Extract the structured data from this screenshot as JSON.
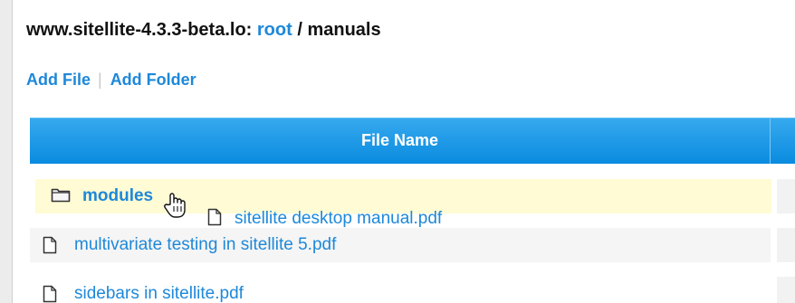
{
  "breadcrumb": {
    "site": "www.sitellite-4.3.3-beta.lo:",
    "root": "root",
    "separator": "/",
    "current": "manuals"
  },
  "actions": {
    "add_file": "Add File",
    "divider": "|",
    "add_folder": "Add Folder"
  },
  "table": {
    "header": "File Name",
    "rows": [
      {
        "name": "modules",
        "icon": "folder-icon",
        "hovered": true
      },
      {
        "name": "multivariate testing in sitellite 5.pdf",
        "icon": "file-icon"
      },
      {
        "name": "sidebars in sitellite.pdf",
        "icon": "file-icon"
      }
    ]
  },
  "drag": {
    "label": "sitellite desktop manual.pdf",
    "icon": "file-icon"
  },
  "colors": {
    "link": "#1e88d9",
    "header_bg": "#0a8bdf",
    "hover_row": "#fffbd4"
  }
}
